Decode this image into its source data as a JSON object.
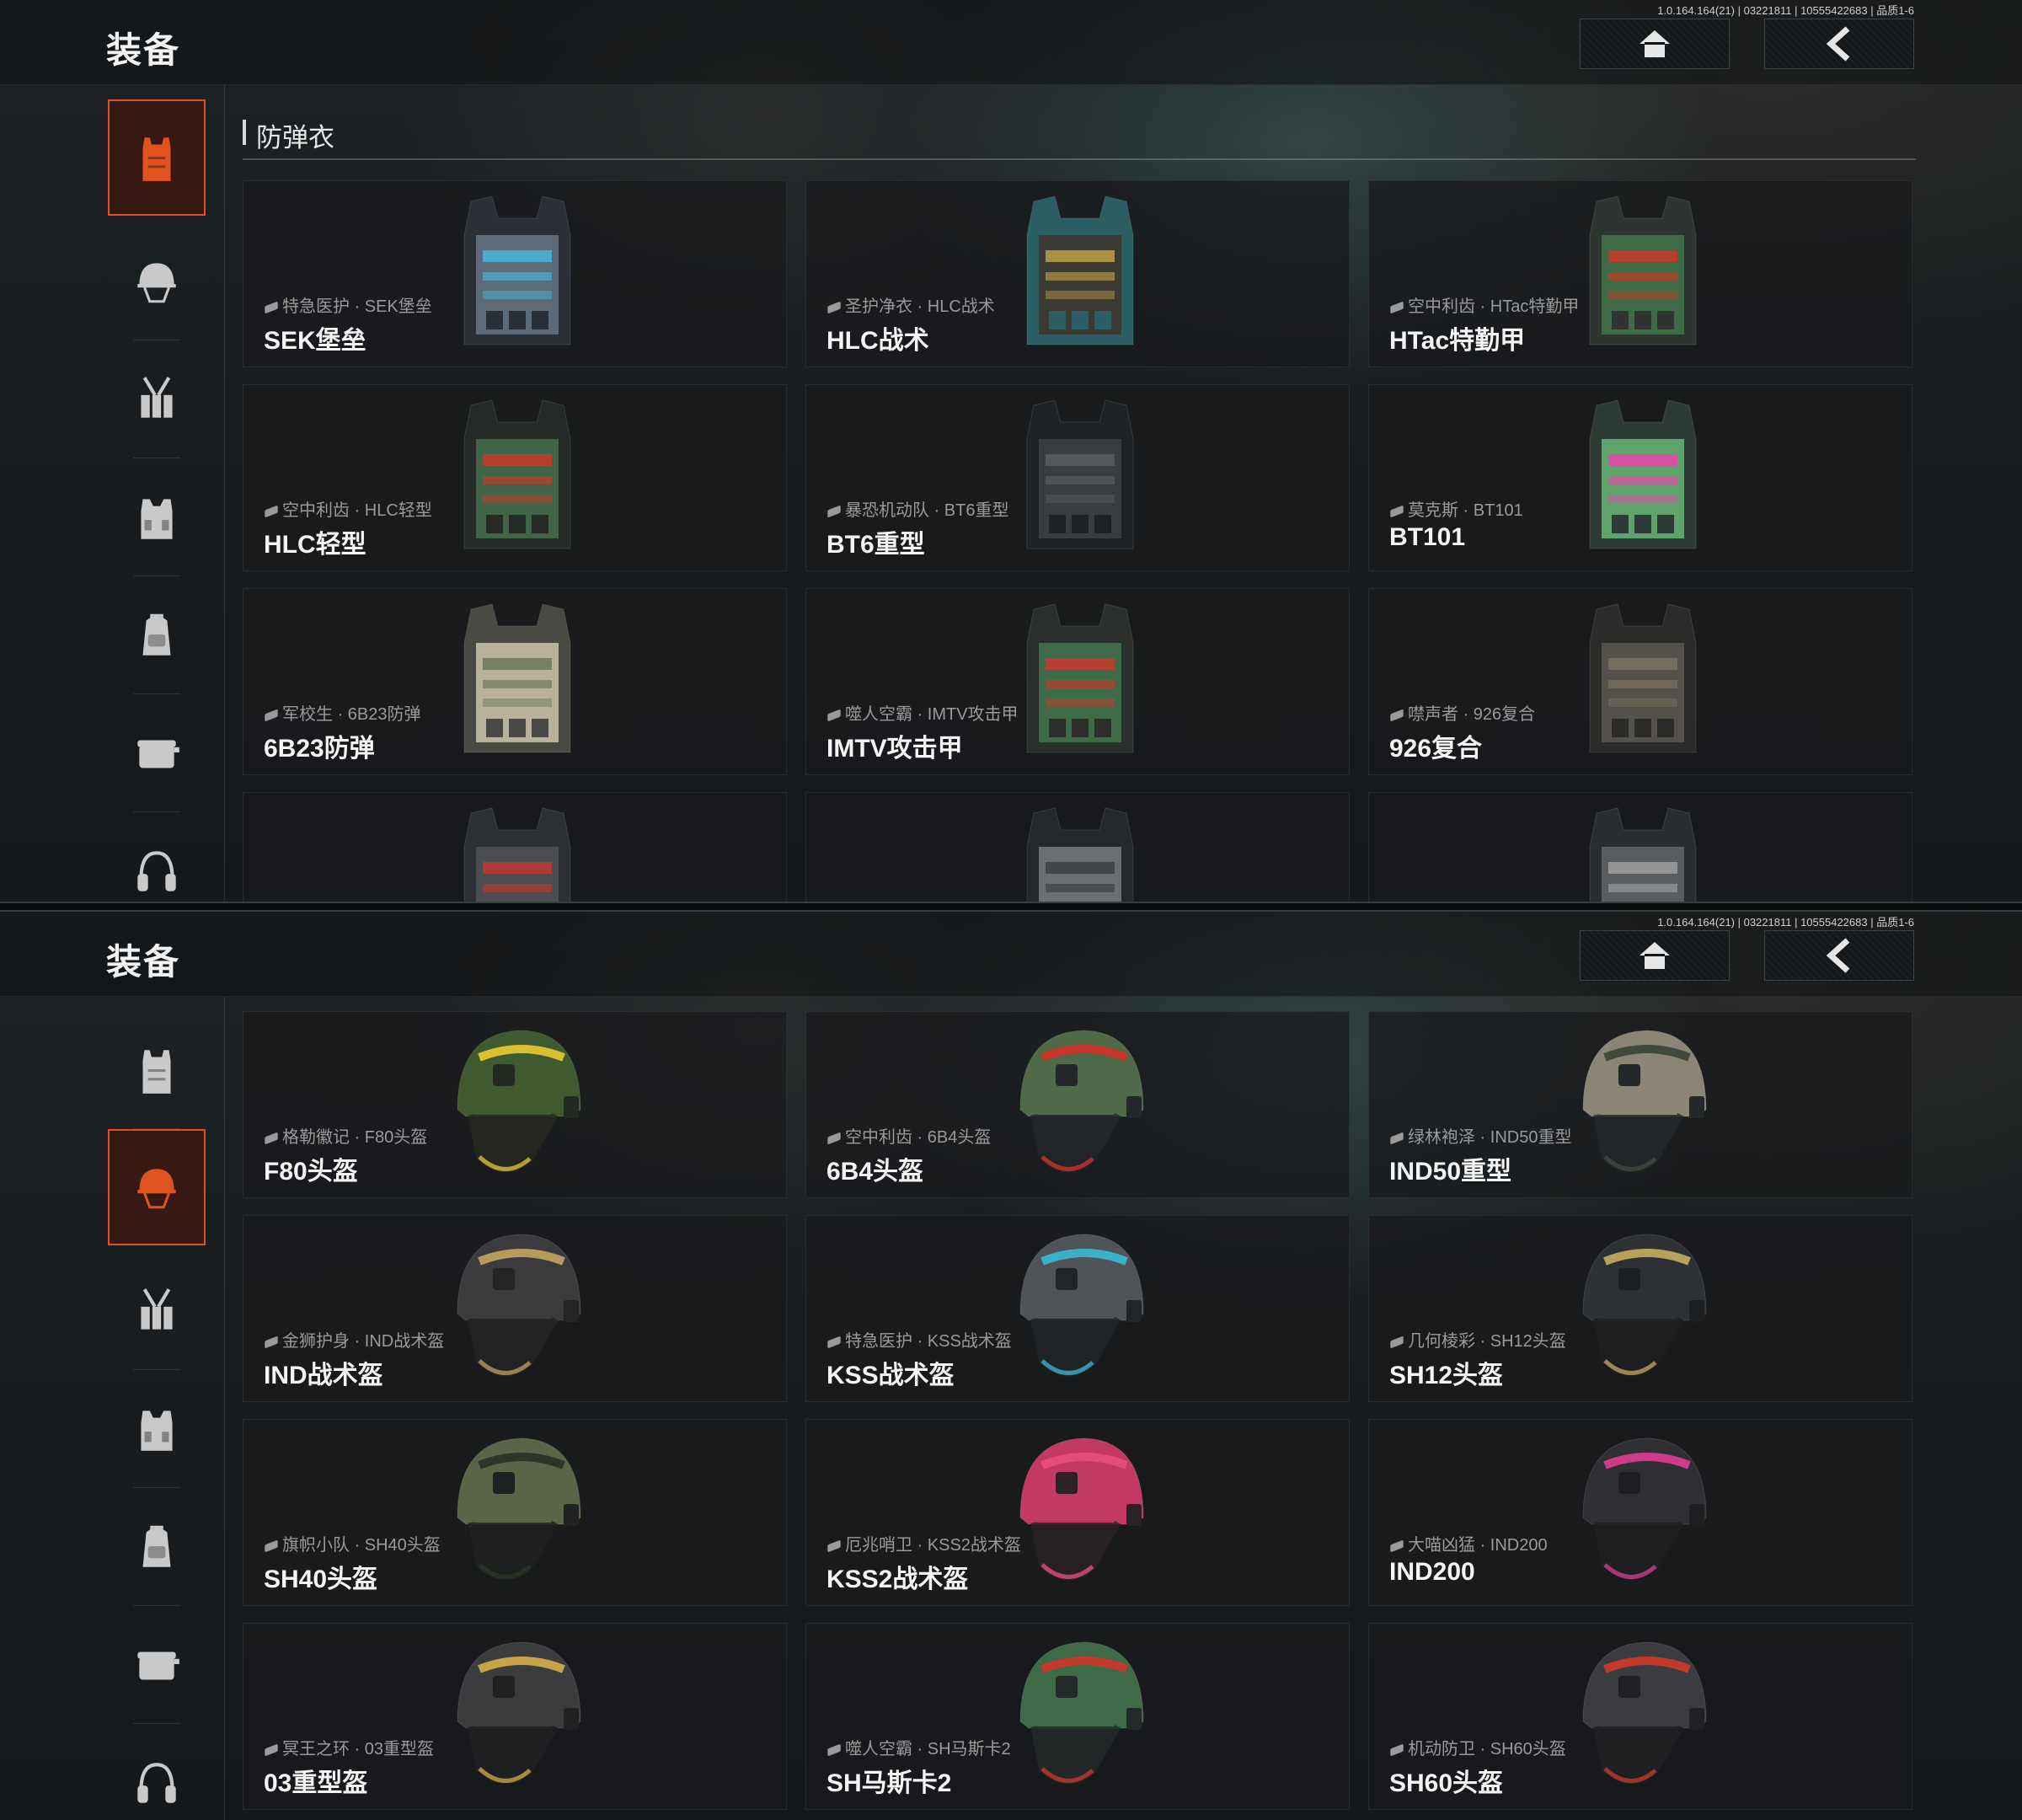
{
  "build_info": "1.0.164.164(21) | 03221811 | 10555422683 | 品质1-6",
  "screen_title": "装备",
  "sidebar_icons": [
    "vest-icon",
    "helmet-icon",
    "chest-rig-icon",
    "tactical-vest-icon",
    "backpack-icon",
    "container-icon",
    "headset-icon"
  ],
  "accent_color": "#e0531f",
  "panel_vests": {
    "active_category": "vest",
    "section_title": "防弹衣",
    "items": [
      {
        "sub": "特急医护 · SEK堡垒",
        "name": "SEK堡垒",
        "colors": [
          "#5d6b78",
          "#4ab3d6",
          "#2a2f35"
        ]
      },
      {
        "sub": "圣护净衣 · HLC战术",
        "name": "HLC战术",
        "colors": [
          "#3b3a33",
          "#b79a47",
          "#2b5e63"
        ]
      },
      {
        "sub": "空中利齿 · HTac特勤甲",
        "name": "HTac特勤甲",
        "colors": [
          "#3e6b45",
          "#c23a2a",
          "#2e3530"
        ]
      },
      {
        "sub": "空中利齿 · HLC轻型",
        "name": "HLC轻型",
        "colors": [
          "#3f6447",
          "#c23a2a",
          "#242a26"
        ]
      },
      {
        "sub": "暴恐机动队 · BT6重型",
        "name": "BT6重型",
        "colors": [
          "#3a3d40",
          "#575b5f",
          "#1f2224"
        ]
      },
      {
        "sub": "莫克斯 · BT101",
        "name": "BT101",
        "colors": [
          "#5fa36c",
          "#e04aa8",
          "#2e3b34"
        ]
      },
      {
        "sub": "军校生 · 6B23防弹",
        "name": "6B23防弹",
        "colors": [
          "#b9b29a",
          "#6f7a5c",
          "#4a4a44"
        ]
      },
      {
        "sub": "噬人空霸 · IMTV攻击甲",
        "name": "IMTV攻击甲",
        "colors": [
          "#3f6a48",
          "#c33b2c",
          "#2a2f2c"
        ]
      },
      {
        "sub": "噤声者 · 926复合",
        "name": "926复合",
        "colors": [
          "#54514a",
          "#7a715e",
          "#2b2c2a"
        ]
      },
      {
        "sub": "",
        "name": "",
        "colors": [
          "#4a4e52",
          "#b83a2e",
          "#2c2f33"
        ]
      },
      {
        "sub": "",
        "name": "",
        "colors": [
          "#6b6f73",
          "#3d4145",
          "#26292c"
        ]
      },
      {
        "sub": "",
        "name": "",
        "colors": [
          "#5a5d60",
          "#9a9a9a",
          "#2a2d30"
        ]
      }
    ]
  },
  "panel_helmets": {
    "active_category": "helmet",
    "items": [
      {
        "sub": "格勒徽记 · F80头盔",
        "name": "F80头盔",
        "colors": [
          "#3f5a2f",
          "#d7c032",
          "#24291f"
        ]
      },
      {
        "sub": "空中利齿 · 6B4头盔",
        "name": "6B4头盔",
        "colors": [
          "#4e6a48",
          "#c8352a",
          "#23272a"
        ]
      },
      {
        "sub": "绿林袍泽 · IND50重型",
        "name": "IND50重型",
        "colors": [
          "#8b8578",
          "#3f4a3c",
          "#25282a"
        ]
      },
      {
        "sub": "金狮护身 · IND战术盔",
        "name": "IND战术盔",
        "colors": [
          "#3a3b3d",
          "#b79a5c",
          "#232426"
        ]
      },
      {
        "sub": "特急医护 · KSS战术盔",
        "name": "KSS战术盔",
        "colors": [
          "#505357",
          "#3bb0c9",
          "#222528"
        ]
      },
      {
        "sub": "几何棱彩 · SH12头盔",
        "name": "SH12头盔",
        "colors": [
          "#2e3134",
          "#b8a15a",
          "#1d1f21"
        ]
      },
      {
        "sub": "旗帜小队 · SH40头盔",
        "name": "SH40头盔",
        "colors": [
          "#5c6448",
          "#2f3427",
          "#1f2220"
        ]
      },
      {
        "sub": "厄兆哨卫 · KSS2战术盔",
        "name": "KSS2战术盔",
        "colors": [
          "#c23a63",
          "#e24d7b",
          "#2a2226"
        ]
      },
      {
        "sub": "大喵凶猛 · IND200",
        "name": "IND200",
        "colors": [
          "#2e2f32",
          "#d03a8a",
          "#1e1f21"
        ]
      },
      {
        "sub": "冥王之环 · 03重型盔",
        "name": "03重型盔",
        "colors": [
          "#3a3c3e",
          "#c7a44a",
          "#1f2122"
        ]
      },
      {
        "sub": "噬人空霸 · SH马斯卡2",
        "name": "SH马斯卡2",
        "colors": [
          "#3f6a48",
          "#c3392b",
          "#24292a"
        ]
      },
      {
        "sub": "机动防卫 · SH60头盔",
        "name": "SH60头盔",
        "colors": [
          "#3a3c3f",
          "#c3392b",
          "#1f2123"
        ]
      }
    ]
  }
}
